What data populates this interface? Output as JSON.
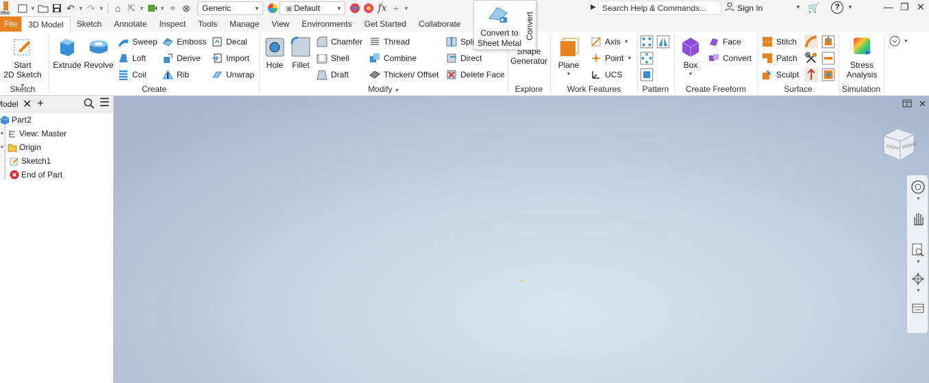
{
  "quick_access": {
    "appearance_value": "Generic",
    "material_value": "Default",
    "search_placeholder": "Search Help & Commands...",
    "sign_in_label": "Sign In",
    "logo_badge": "PRO"
  },
  "tabs": [
    {
      "label": "File"
    },
    {
      "label": "3D Model"
    },
    {
      "label": "Sketch"
    },
    {
      "label": "Annotate"
    },
    {
      "label": "Inspect"
    },
    {
      "label": "Tools"
    },
    {
      "label": "Manage"
    },
    {
      "label": "View"
    },
    {
      "label": "Environments"
    },
    {
      "label": "Get Started"
    },
    {
      "label": "Collaborate"
    }
  ],
  "ribbon": {
    "sketch": {
      "start_label_1": "Start",
      "start_label_2": "2D Sketch",
      "panel": "Sketch"
    },
    "create": {
      "extrude": "Extrude",
      "revolve": "Revolve",
      "sweep": "Sweep",
      "loft": "Loft",
      "coil": "Coil",
      "emboss": "Emboss",
      "derive": "Derive",
      "rib": "Rib",
      "decal": "Decal",
      "import": "Import",
      "unwrap": "Unwrap",
      "panel": "Create"
    },
    "modify": {
      "hole": "Hole",
      "fillet": "Fillet",
      "chamfer": "Chamfer",
      "shell": "Shell",
      "draft": "Draft",
      "thread": "Thread",
      "combine": "Combine",
      "thicken": "Thicken/ Offset",
      "split": "Split",
      "direct": "Direct",
      "delete_face": "Delete Face",
      "panel": "Modify"
    },
    "convert_popup": {
      "line1": "Convert to",
      "line2": "Sheet Metal",
      "vertical": "Convert"
    },
    "explore": {
      "shape_1": "Shape",
      "shape_2": "Generator",
      "panel": "Explore"
    },
    "work_features": {
      "plane": "Plane",
      "axis": "Axis",
      "point": "Point",
      "ucs": "UCS",
      "panel": "Work Features"
    },
    "pattern": {
      "panel": "Pattern"
    },
    "freeform": {
      "box": "Box",
      "face": "Face",
      "convert": "Convert",
      "panel": "Create Freeform"
    },
    "surface": {
      "stitch": "Stitch",
      "patch": "Patch",
      "sculpt": "Sculpt",
      "panel": "Surface"
    },
    "simulation": {
      "stress_1": "Stress",
      "stress_2": "Analysis",
      "panel": "Simulation"
    }
  },
  "browser": {
    "title": "Model",
    "nodes": [
      {
        "label": "Part2"
      },
      {
        "label": "View: Master"
      },
      {
        "label": "Origin"
      },
      {
        "label": "Sketch1"
      },
      {
        "label": "End of Part"
      }
    ]
  },
  "viewcube": {
    "face_right": "RIGHT",
    "face_front": "FRONT"
  },
  "colors": {
    "accent_orange": "#e8821e",
    "viewport_light": "#dbe5f1",
    "viewport_dark": "#a9b8cf",
    "icon_blue": "#3a8fd6"
  }
}
